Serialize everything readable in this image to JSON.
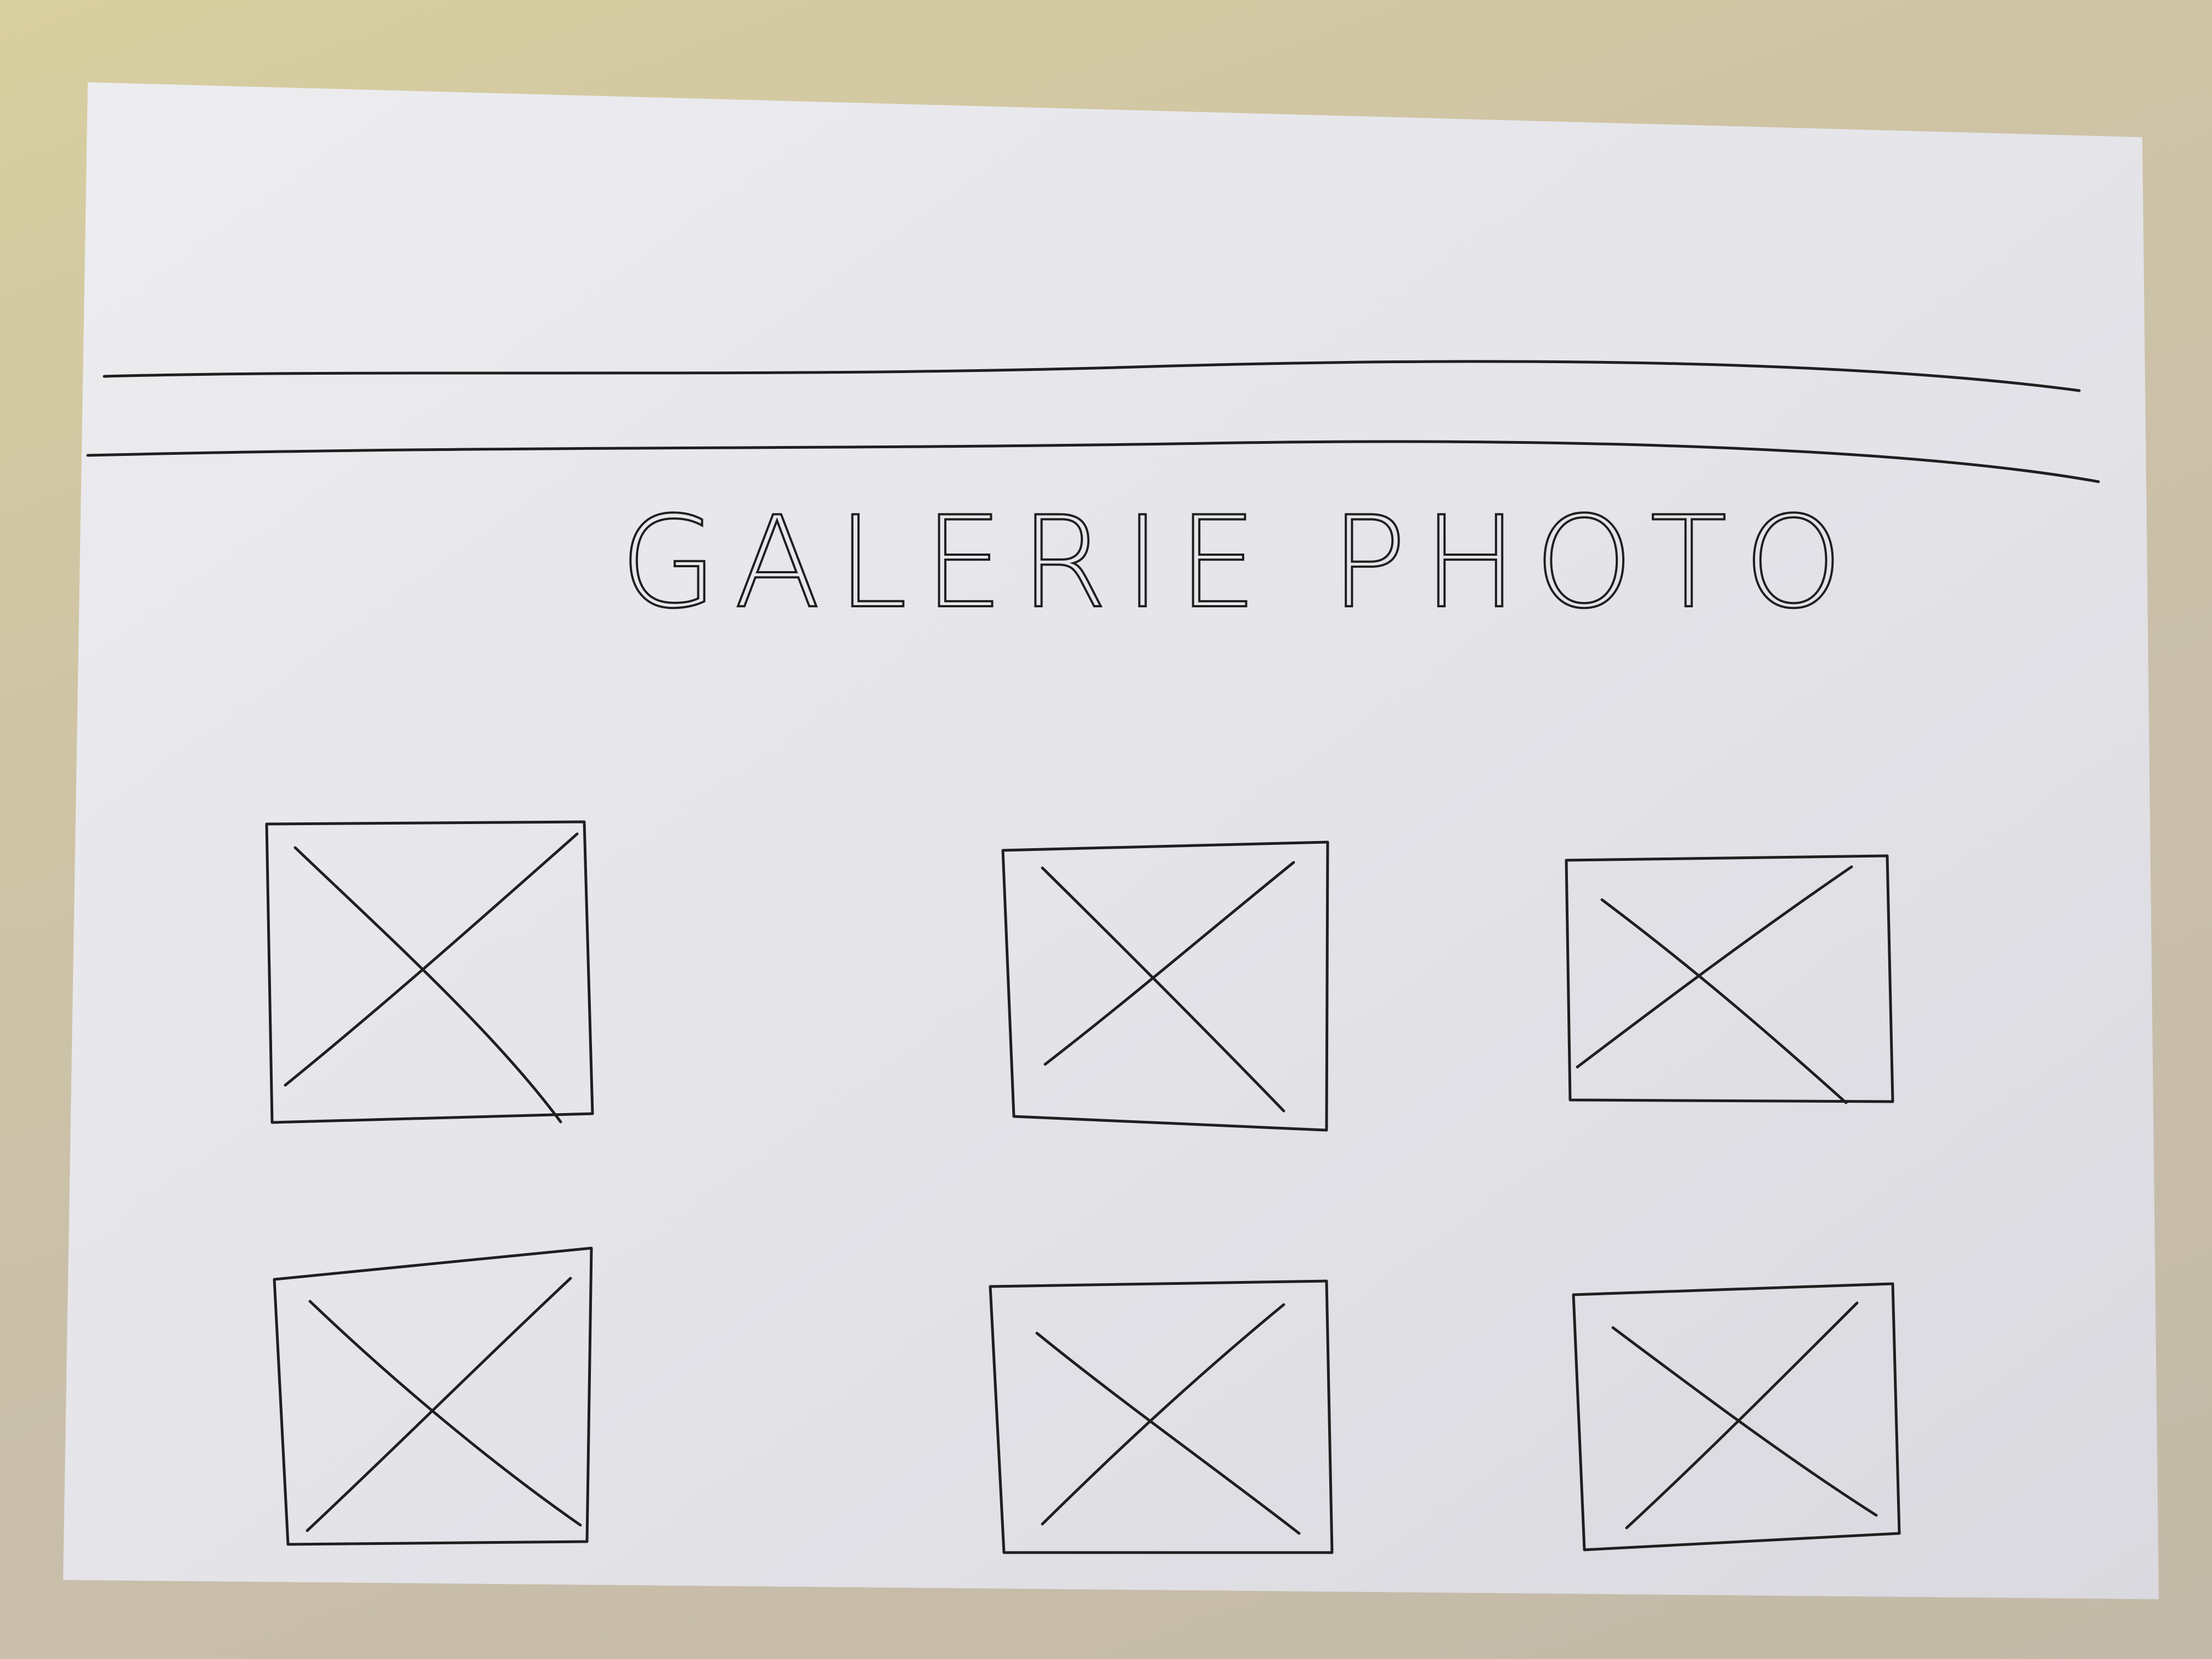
{
  "page": {
    "title": "GALERIE PHOTO"
  },
  "colors": {
    "paper": "#e6e6ea",
    "ink": "#1f1f1f",
    "background": "#cdc3a6"
  },
  "gallery": {
    "items": [
      {
        "icon": "image-placeholder-icon"
      },
      {
        "icon": "image-placeholder-icon"
      },
      {
        "icon": "image-placeholder-icon"
      },
      {
        "icon": "image-placeholder-icon"
      },
      {
        "icon": "image-placeholder-icon"
      },
      {
        "icon": "image-placeholder-icon"
      }
    ]
  }
}
